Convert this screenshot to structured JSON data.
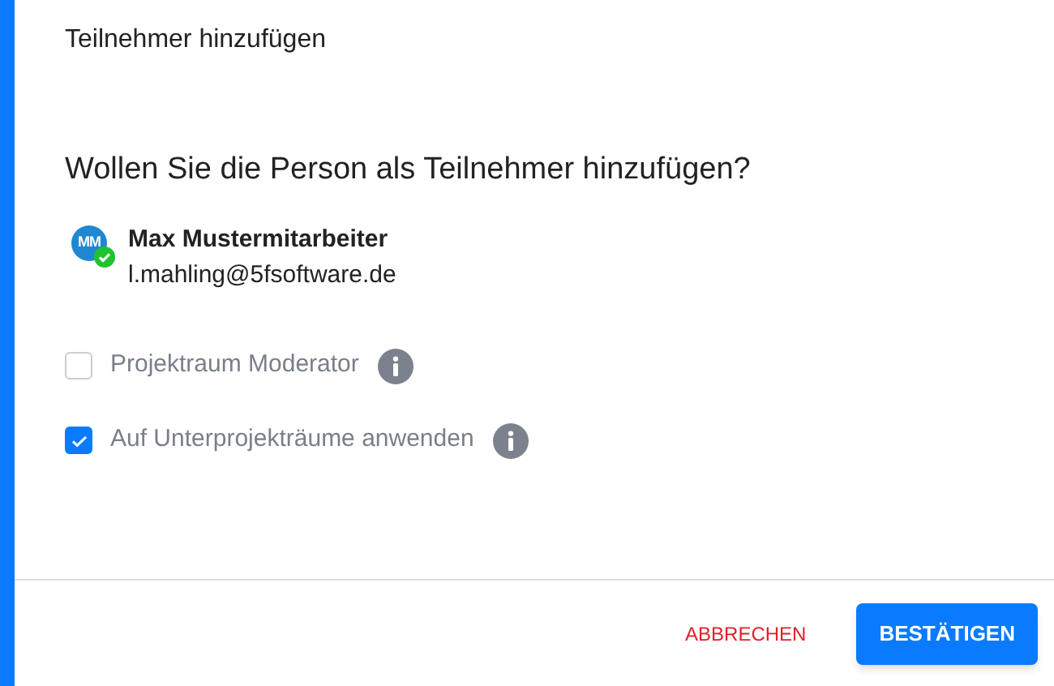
{
  "dialog": {
    "title": "Teilnehmer hinzufügen"
  },
  "question": "Wollen Sie die Person als Teilnehmer hinzufügen?",
  "person": {
    "initials": "MM",
    "name": "Max Mustermitarbeiter",
    "email": "l.mahling@5fsoftware.de"
  },
  "options": [
    {
      "label": "Projektraum Moderator",
      "checked": false
    },
    {
      "label": "Auf Unterprojekträume anwenden",
      "checked": true
    }
  ],
  "buttons": [
    {
      "label": "ABBRECHEN",
      "kind": "text"
    },
    {
      "label": "BESTÄTIGEN",
      "kind": "primary"
    }
  ]
}
